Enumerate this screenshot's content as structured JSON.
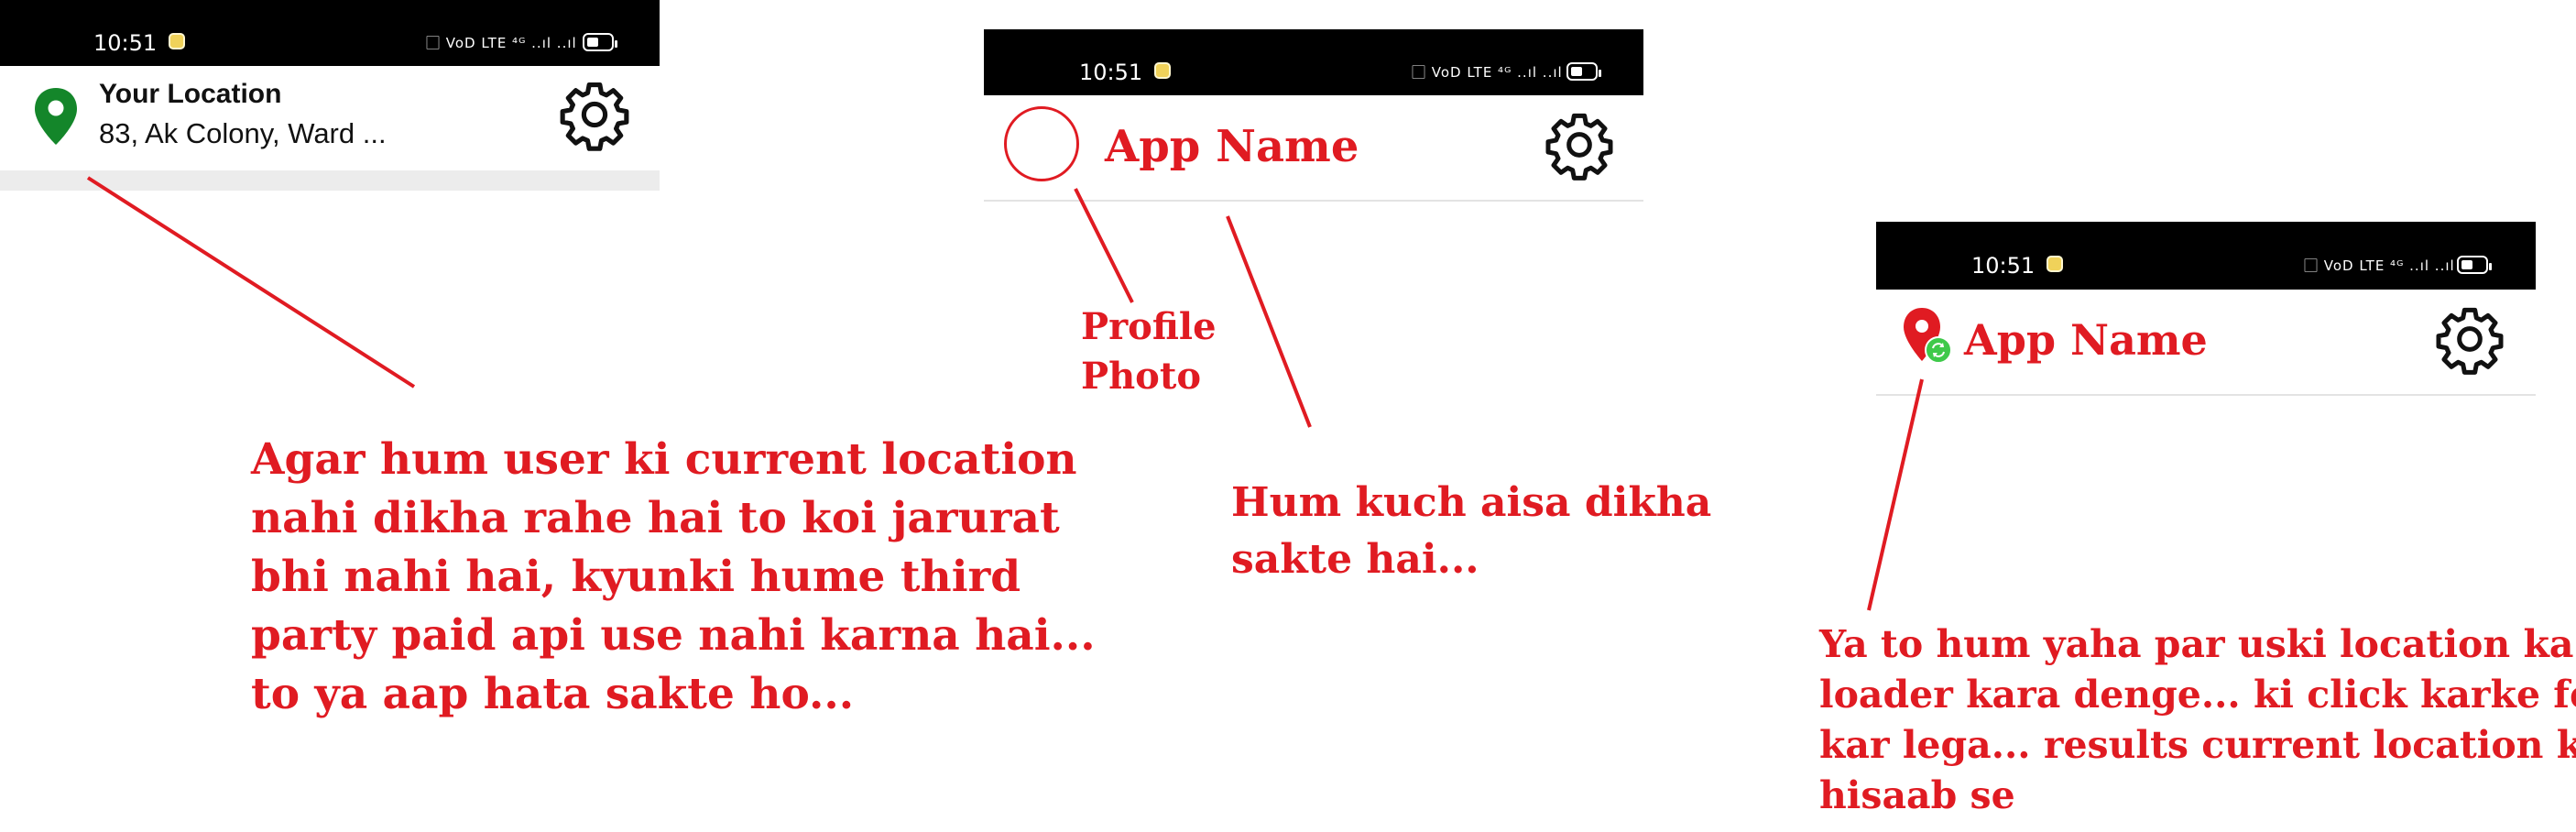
{
  "status_bar": {
    "time": "10:51",
    "icons": "⃞ VoD LTE ⁴ᴳ ..ıl ..ıl"
  },
  "mock1": {
    "location_title": "Your Location",
    "location_address": "83, Ak Colony, Ward ...",
    "icons": {
      "location": "map-pin-icon",
      "settings": "gear-icon"
    },
    "colors": {
      "pin": "#14862a"
    }
  },
  "mock2": {
    "app_name": "App Name",
    "icons": {
      "profile": "profile-circle-icon",
      "settings": "gear-icon"
    }
  },
  "mock3": {
    "app_name": "App Name",
    "icons": {
      "location": "location-pin-refresh-icon",
      "settings": "gear-icon"
    },
    "colors": {
      "pin": "#e01b22",
      "refresh": "#3ec94a"
    }
  },
  "annotations": {
    "note1": [
      "Agar hum user ki current location",
      "nahi dikha rahe hai to koi jarurat",
      "bhi nahi hai, kyunki hume third",
      "party paid api use nahi karna hai...",
      "to ya aap hata sakte ho..."
    ],
    "profile_label": [
      "Profile",
      "Photo"
    ],
    "note2": [
      "Hum kuch aisa dikha",
      "sakte hai..."
    ],
    "note3": [
      "Ya to hum yaha par uski location ka",
      "loader kara denge... ki click karke fetch",
      "kar lega... results current location ke",
      "hisaab se"
    ]
  },
  "colors": {
    "annotation": "#e01b22",
    "statusbar": "#000000"
  }
}
